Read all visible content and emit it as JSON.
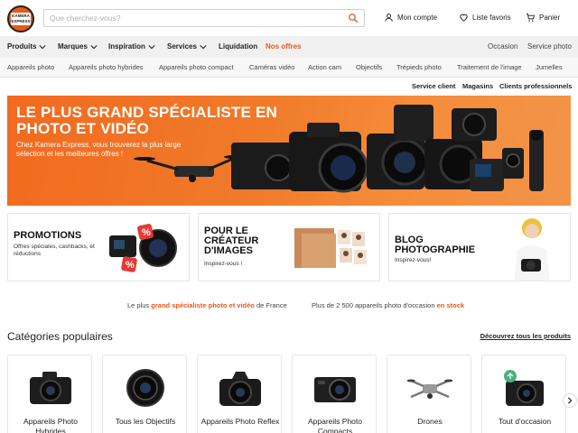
{
  "header": {
    "logo_text": "KAMERA EXPRESS",
    "search_placeholder": "Que cherchez-vous?",
    "account_label": "Mon compte",
    "wishlist_label": "Liste favoris",
    "cart_label": "Panier"
  },
  "nav": {
    "items": [
      {
        "label": "Produits",
        "has_dropdown": true
      },
      {
        "label": "Marques",
        "has_dropdown": true
      },
      {
        "label": "Inspiration",
        "has_dropdown": true
      },
      {
        "label": "Services",
        "has_dropdown": true
      },
      {
        "label": "Liquidation",
        "has_dropdown": false
      },
      {
        "label": "Nos offres",
        "has_dropdown": false
      }
    ],
    "right": [
      "Occasion",
      "Service photo"
    ]
  },
  "subnav": [
    "Appareils photo",
    "Appareils photo hybrides",
    "Appareils photo compact",
    "Caméras vidéo",
    "Action cam",
    "Objectifs",
    "Trépieds photo",
    "Traitement de l'image",
    "Jumelles"
  ],
  "service_links": [
    "Service client",
    "Magasins",
    "Clients professionnels"
  ],
  "hero": {
    "title": "LE PLUS GRAND SPÉCIALISTE EN PHOTO ET VIDÉO",
    "subtitle": "Chez Kamera Express, vous trouverez la plus large sélection et les meilleures offres !"
  },
  "promos": [
    {
      "title": "PROMOTIONS",
      "subtitle": "Offres spéciales, cashbacks, et réductions"
    },
    {
      "title": "POUR LE CRÉATEUR D'IMAGES",
      "subtitle": "Inspirez-vous !"
    },
    {
      "title": "BLOG PHOTOGRAPHIE",
      "subtitle": "Inspirez-vous!"
    }
  ],
  "info": {
    "left_prefix": "Le plus",
    "left_bold": "grand spécialiste photo et vidéo",
    "left_suffix": "de France",
    "right_prefix": "Plus de 2 500 appareils photo d'occasion",
    "right_bold": "en stock"
  },
  "categories": {
    "heading": "Catégories populaires",
    "link": "Découvrez tous les produits",
    "items": [
      {
        "label": "Appareils Photo Hybrides",
        "icon": "mirrorless-camera-icon"
      },
      {
        "label": "Tous les Objectifs",
        "icon": "lens-icon"
      },
      {
        "label": "Appareils Photo Reflex",
        "icon": "dslr-camera-icon"
      },
      {
        "label": "Appareils Photo Compacts",
        "icon": "compact-camera-icon"
      },
      {
        "label": "Drones",
        "icon": "drone-icon"
      },
      {
        "label": "Tout d'occasion",
        "icon": "used-camera-icon"
      }
    ]
  },
  "colors": {
    "accent": "#e8591a",
    "nav_bg": "#f0f0f0"
  }
}
